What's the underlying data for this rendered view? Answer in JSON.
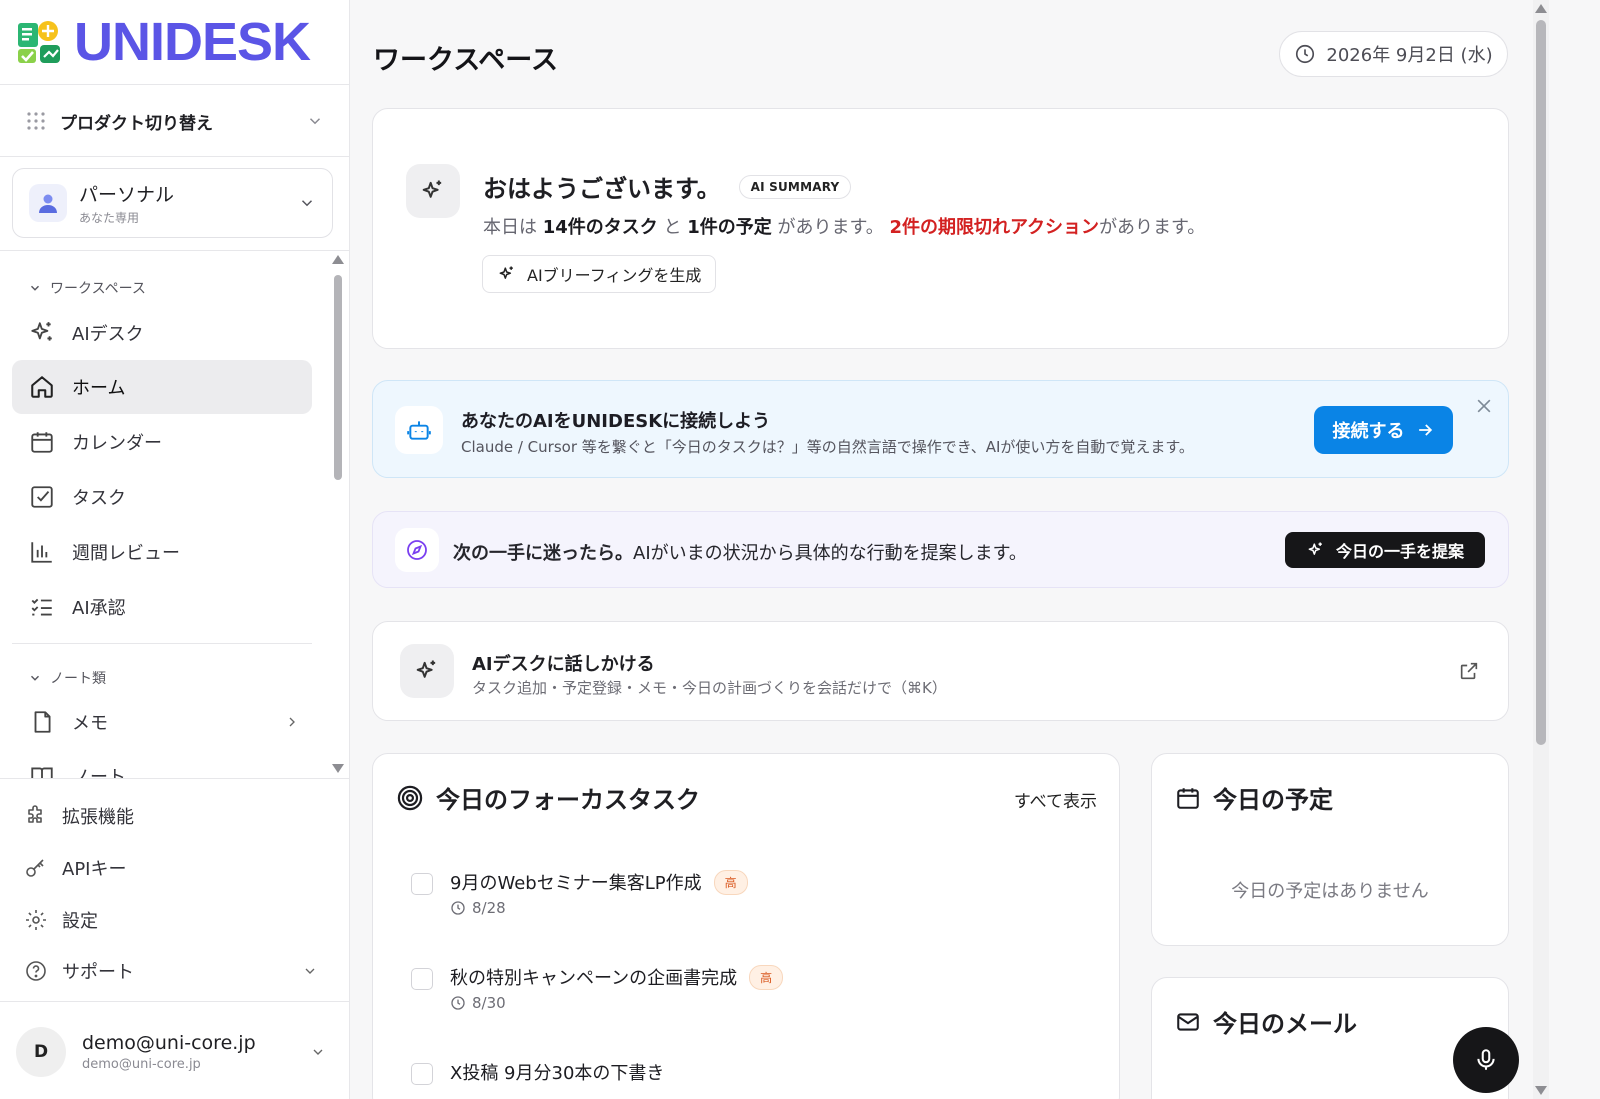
{
  "app": {
    "logo_text": "UNIDESK",
    "brand_color": "#5b55e6"
  },
  "sidebar": {
    "product_switch": {
      "label": "プロダクト切り替え",
      "icon": "grid-dots-icon"
    },
    "workspace_selector": {
      "name": "パーソナル",
      "subtitle": "あなた専用",
      "icon": "user-icon"
    },
    "sections": [
      {
        "label": "ワークスペース",
        "items": [
          {
            "label": "AIデスク",
            "icon": "sparkles-icon",
            "active": false
          },
          {
            "label": "ホーム",
            "icon": "home-icon",
            "active": true
          },
          {
            "label": "カレンダー",
            "icon": "calendar-icon",
            "active": false
          },
          {
            "label": "タスク",
            "icon": "checkbox-icon",
            "active": false
          },
          {
            "label": "週間レビュー",
            "icon": "bar-chart-icon",
            "active": false
          },
          {
            "label": "AI承認",
            "icon": "list-check-icon",
            "active": false
          }
        ]
      },
      {
        "label": "ノート類",
        "items": [
          {
            "label": "メモ",
            "icon": "file-icon",
            "has_children": true
          },
          {
            "label": "ノート",
            "icon": "book-icon",
            "has_children": false
          }
        ]
      }
    ],
    "bottom_items": [
      {
        "label": "拡張機能",
        "icon": "puzzle-icon"
      },
      {
        "label": "APIキー",
        "icon": "key-icon"
      },
      {
        "label": "設定",
        "icon": "gear-icon"
      },
      {
        "label": "サポート",
        "icon": "help-circle-icon",
        "expandable": true
      }
    ],
    "user": {
      "initial": "D",
      "name": "demo@uni-core.jp",
      "email": "demo@uni-core.jp"
    }
  },
  "header": {
    "title": "ワークスペース",
    "date": "2026年 9月2日 (水)"
  },
  "summary": {
    "greeting": "おはようございます。",
    "badge": "AI SUMMARY",
    "line": {
      "p1": "本日は ",
      "tasks": "14件のタスク",
      "p2": " と ",
      "events": "1件の予定",
      "p3": " があります。 ",
      "overdue": "2件の期限切れアクション",
      "p4": "があります。"
    },
    "brief_button": "AIブリーフィングを生成"
  },
  "connect_banner": {
    "title": "あなたのAIをUNIDESKに接続しよう",
    "subtitle": "Claude / Cursor 等を繋ぐと「今日のタスクは？」等の自然言語で操作でき、AIが使い方を自動で覚えます。",
    "button": "接続する",
    "accent": "#0a84e6"
  },
  "next_action": {
    "bold": "次の一手に迷ったら。",
    "text": "AIがいまの状況から具体的な行動を提案します。",
    "button": "今日の一手を提案"
  },
  "talk": {
    "title": "AIデスクに話しかける",
    "subtitle": "タスク追加・予定登録・メモ・今日の計画づくりを会話だけで（⌘K）"
  },
  "focus_tasks": {
    "title": "今日のフォーカスタスク",
    "view_all": "すべて表示",
    "items": [
      {
        "title": "9月のWebセミナー集客LP作成",
        "priority": "高",
        "due": "8/28"
      },
      {
        "title": "秋の特別キャンペーンの企画書完成",
        "priority": "高",
        "due": "8/30"
      },
      {
        "title": "X投稿 9月分30本の下書き",
        "priority": "",
        "due": ""
      }
    ]
  },
  "schedule": {
    "title": "今日の予定",
    "empty": "今日の予定はありません"
  },
  "mail": {
    "title": "今日のメール"
  }
}
